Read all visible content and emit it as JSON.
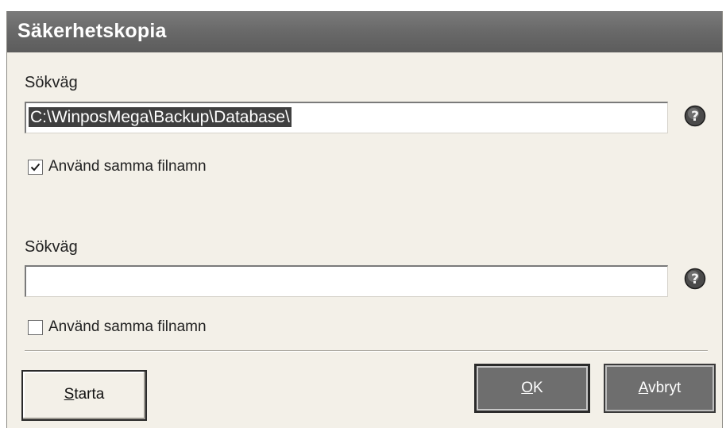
{
  "window": {
    "title": "Säkerhetskopia"
  },
  "path1": {
    "label": "Sökväg",
    "value": "C:\\WinposMega\\Backup\\Database\\",
    "help_icon": "question-icon",
    "same_filename": {
      "label": "Använd samma filnamn",
      "checked": true
    }
  },
  "path2": {
    "label": "Sökväg",
    "value": "",
    "help_icon": "question-icon",
    "same_filename": {
      "label": "Använd samma filnamn",
      "checked": false
    }
  },
  "buttons": {
    "start": {
      "mnemonic": "S",
      "rest": "tarta"
    },
    "ok": {
      "mnemonic": "O",
      "rest": "K"
    },
    "cancel": {
      "mnemonic": "A",
      "rest": "vbryt"
    }
  },
  "colors": {
    "titlebar": "#6a6a6a",
    "dialog_bg": "#f3f0e8",
    "button_dark": "#6e6e6e"
  }
}
